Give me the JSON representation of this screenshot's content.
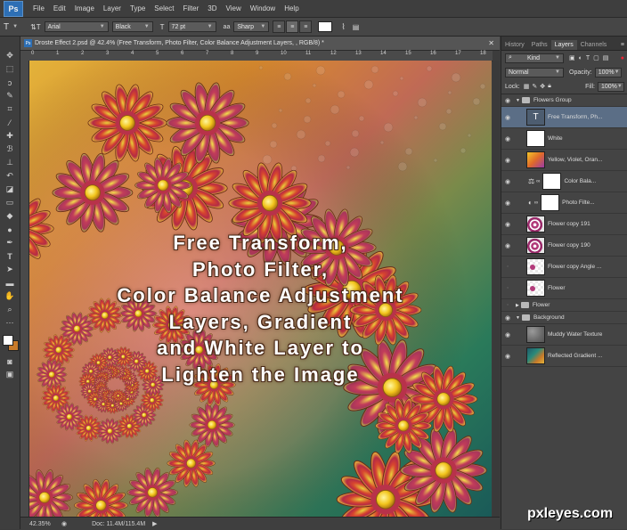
{
  "menubar": {
    "logo": "Ps",
    "items": [
      "File",
      "Edit",
      "Image",
      "Layer",
      "Type",
      "Select",
      "Filter",
      "3D",
      "View",
      "Window",
      "Help"
    ]
  },
  "options": {
    "tool_glyph": "T",
    "orient_glyph": "⇅T",
    "font_family": "Arial",
    "font_style": "Black",
    "size_glyph": "T",
    "font_size": "72 pt",
    "aa_glyph": "aa",
    "antialias": "Sharp",
    "text_color": "#ffffff"
  },
  "document": {
    "tab_label": "Droste Effect 2.psd @ 42.4% (Free Transform, Photo Filter, Color Balance Adjustment Layers, , RGB/8) *",
    "ruler_ticks": [
      "0",
      "1",
      "2",
      "3",
      "4",
      "5",
      "6",
      "7",
      "8",
      "9",
      "10",
      "11",
      "12",
      "13",
      "14",
      "15",
      "16",
      "17",
      "18"
    ],
    "canvas_text": [
      "Free Transform,",
      "Photo Filter,",
      "Color Balance Adjustment",
      "Layers, Gradient",
      "and White Layer to",
      "Lighten the Image"
    ]
  },
  "status": {
    "zoom": "42.35%",
    "doc": "Doc: 11.4M/115.4M"
  },
  "panel": {
    "tabs": [
      "History",
      "Paths",
      "Layers",
      "Channels"
    ],
    "active_tab": "Layers",
    "filter_kind": "Kind",
    "blend_mode": "Normal",
    "opacity_label": "Opacity:",
    "opacity_value": "100%",
    "lock_label": "Lock:",
    "fill_label": "Fill:",
    "fill_value": "100%",
    "layers": [
      {
        "type": "group",
        "name": "Flowers Group"
      },
      {
        "type": "layer",
        "name": "Free Transform, Ph...",
        "thumb": "text",
        "selected": true
      },
      {
        "type": "layer",
        "name": "White",
        "thumb": "white"
      },
      {
        "type": "layer",
        "name": "Yellow, Violet, Oran...",
        "thumb": "gradient"
      },
      {
        "type": "layer",
        "name": "Color Bala...",
        "thumb": "adjust"
      },
      {
        "type": "layer",
        "name": "Photo Filte...",
        "thumb": "adjust"
      },
      {
        "type": "layer",
        "name": "Flower  copy 191",
        "thumb": "swirl"
      },
      {
        "type": "layer",
        "name": "Flower  copy 190",
        "thumb": "swirl"
      },
      {
        "type": "layer",
        "name": "Flower  copy Angle ...",
        "thumb": "checker"
      },
      {
        "type": "layer",
        "name": "Flower",
        "thumb": "checker"
      },
      {
        "type": "group",
        "name": "Flower"
      },
      {
        "type": "group",
        "name": "Background"
      },
      {
        "type": "layer",
        "name": "Muddy Water Texture",
        "thumb": "texture"
      },
      {
        "type": "layer",
        "name": "Reflected Gradient ...",
        "thumb": "reflected"
      }
    ]
  },
  "watermark": "pxleyes.com",
  "colors": {
    "accent_selected": "#5b6e86",
    "ps_blue": "#2d6fb5"
  }
}
